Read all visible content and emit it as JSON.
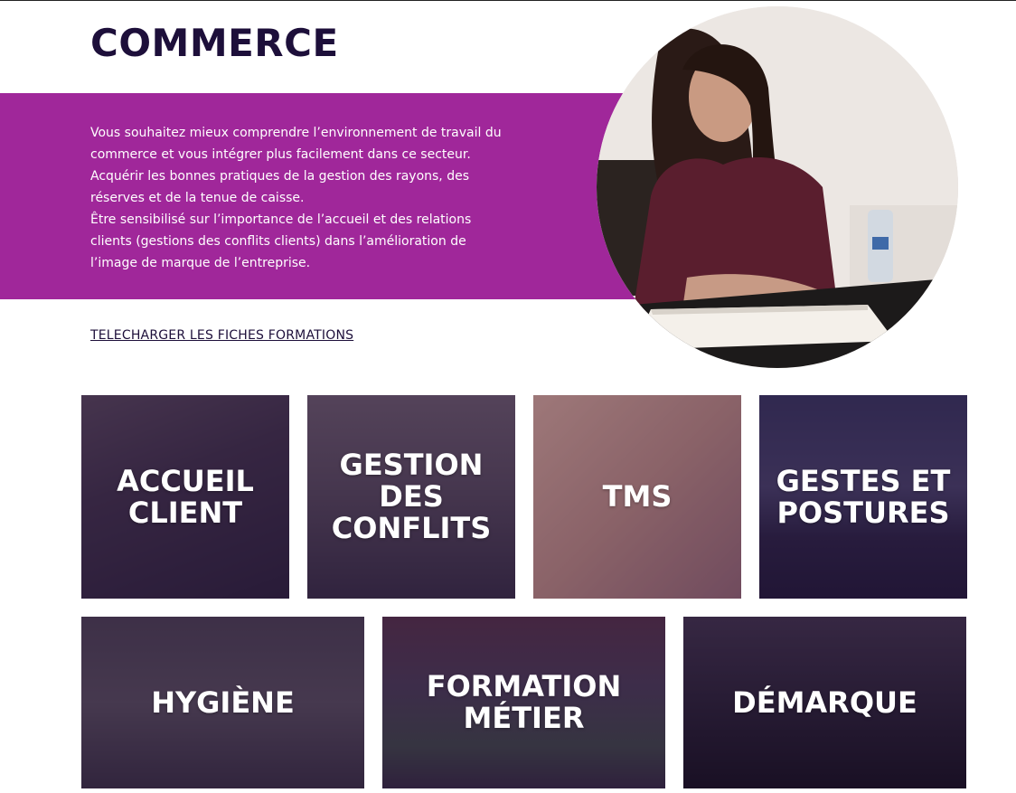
{
  "header": {
    "title": "COMMERCE"
  },
  "intro": {
    "paragraphs": [
      "Vous souhaitez mieux comprendre l’environnement de travail du commerce et vous intégrer plus facilement dans ce secteur.",
      "Acquérir les bonnes pratiques de la gestion des rayons, des réserves et de la tenue de caisse.",
      "Être sensibilisé sur l’importance de l’accueil et des relations clients (gestions des conflits clients) dans l’amélioration de l’image de marque de l’entreprise."
    ]
  },
  "download_link": "TELECHARGER LES FICHES FORMATIONS",
  "tiles": [
    {
      "label": "ACCUEIL\nCLIENT"
    },
    {
      "label": "GESTION\nDES\nCONFLITS"
    },
    {
      "label": "TMS"
    },
    {
      "label": "GESTES ET\nPOSTURES"
    },
    {
      "label": "HYGIÈNE"
    },
    {
      "label": "FORMATION\nMÉTIER"
    },
    {
      "label": "DÉMARQUE"
    }
  ],
  "colors": {
    "accent": "#a0279a",
    "title": "#1d0f3a",
    "tile_overlay": "#26163a"
  }
}
